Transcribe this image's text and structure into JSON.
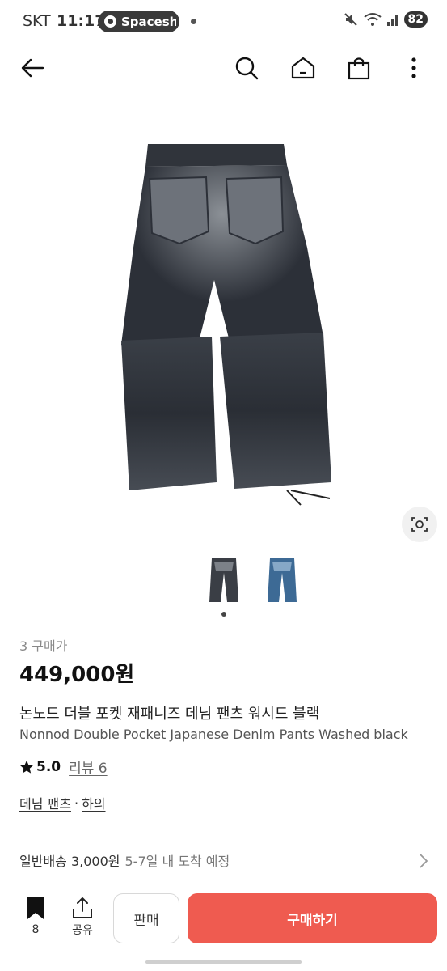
{
  "status_bar": {
    "carrier": "SKT",
    "time": "11:17",
    "app_pill_label": "Spacesh",
    "battery": "82"
  },
  "product": {
    "purchase_count": "3 구매가",
    "price": "449,000원",
    "title_ko": "논노드 더블 포켓 재패니즈 데님 팬츠 워시드 블랙",
    "title_en": "Nonnod Double Pocket Japanese Denim Pants Washed black",
    "rating": "5.0",
    "review_label": "리뷰 6",
    "category": "데님 팬츠",
    "category_parent": "하의"
  },
  "shipping": {
    "label": "일반배송 3,000원",
    "eta": "5-7일 내 도착 예정"
  },
  "bottom_bar": {
    "bookmark_count": "8",
    "share_label": "공유",
    "sell_label": "판매",
    "buy_label": "구매하기"
  },
  "colors": {
    "buy_button": "#ef5b50"
  }
}
